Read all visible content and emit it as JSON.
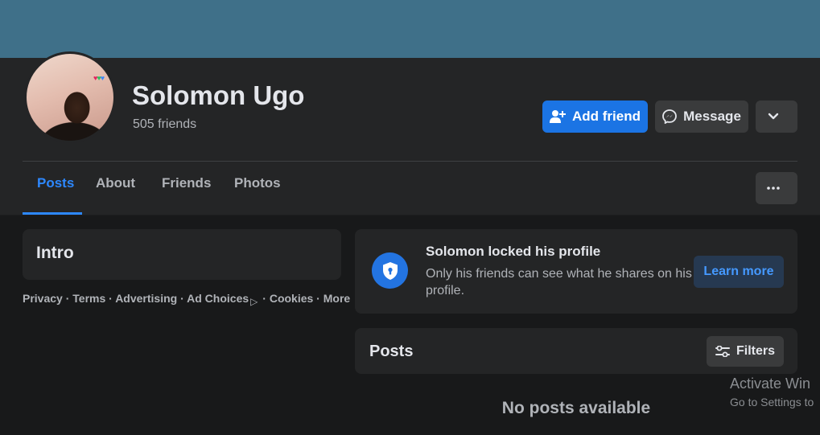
{
  "profile": {
    "name": "Solomon Ugo",
    "friends_count": "505 friends",
    "avatar_badge": "♥♥♥"
  },
  "actions": {
    "add_friend": "Add friend",
    "message": "Message"
  },
  "tabs": [
    {
      "label": "Posts",
      "active": true
    },
    {
      "label": "About"
    },
    {
      "label": "Friends"
    },
    {
      "label": "Photos"
    }
  ],
  "intro": {
    "title": "Intro"
  },
  "footer": {
    "privacy": "Privacy",
    "terms": "Terms",
    "advertising": "Advertising",
    "ad_choices": "Ad Choices",
    "cookies": "Cookies",
    "more": "More",
    "separator": " · "
  },
  "locked": {
    "title": "Solomon locked his profile",
    "description": "Only his friends can see what he shares on his profile.",
    "learn_more": "Learn more"
  },
  "posts": {
    "title": "Posts",
    "filters": "Filters",
    "empty": "No posts available"
  },
  "watermark": {
    "title": "Activate Win",
    "subtitle": "Go to Settings to"
  },
  "colors": {
    "accent": "#2d88ff",
    "primary_button": "#1b74e4",
    "background": "#18191a",
    "surface": "#242526",
    "cover": "#3f7089"
  }
}
